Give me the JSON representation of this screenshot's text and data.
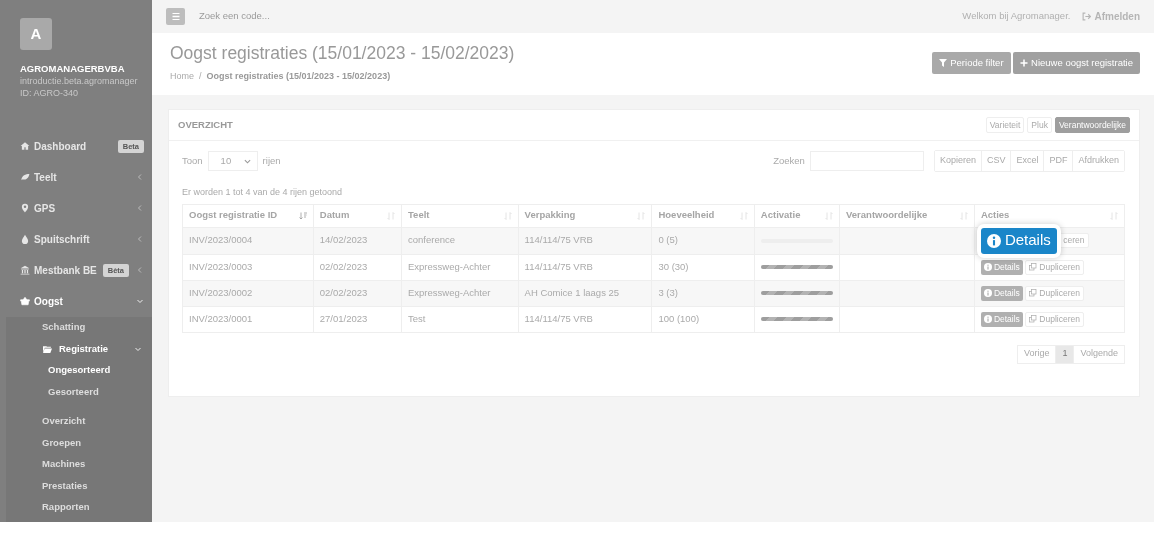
{
  "sidebar": {
    "logo": "A",
    "company": "AGROMANAGERBVBA",
    "subtitle": "introductie.beta.agromanager",
    "account_id": "ID: AGRO-340",
    "items": [
      {
        "label": "Dashboard",
        "badge": "Beta",
        "selected": false
      },
      {
        "label": "Teelt",
        "expanded": false,
        "selected": false
      },
      {
        "label": "GPS",
        "expanded": false,
        "selected": false
      },
      {
        "label": "Spuitschrift",
        "expanded": false,
        "selected": false
      },
      {
        "label": "Mestbank BE",
        "badge": "Bèta",
        "expanded": false,
        "selected": false
      },
      {
        "label": "Oogst",
        "expanded": true,
        "selected": true,
        "children": [
          {
            "label": "Schatting",
            "selected": false
          },
          {
            "label": "Registratie",
            "expanded": true,
            "selected": true,
            "children": [
              {
                "label": "Ongesorteerd",
                "selected": true
              },
              {
                "label": "Gesorteerd",
                "selected": false
              }
            ]
          },
          {
            "label": "Overzicht",
            "selected": false
          },
          {
            "label": "Groepen",
            "selected": false
          },
          {
            "label": "Machines",
            "selected": false
          },
          {
            "label": "Prestaties",
            "selected": false
          },
          {
            "label": "Rapporten",
            "selected": false
          }
        ]
      }
    ]
  },
  "topbar": {
    "search": {
      "placeholder": "Zoek een code..."
    },
    "welcome": "Welkom bij Agromanager.",
    "logout": "Afmelden"
  },
  "page": {
    "title": "Oogst registraties (15/01/2023 - 15/02/2023)",
    "breadcrumb_separator": "/",
    "breadcrumb": [
      "Home",
      "Oogst registraties (15/01/2023 - 15/02/2023)"
    ],
    "buttons": [
      "Periode filter",
      "Nieuwe oogst registratie"
    ]
  },
  "card": {
    "title": "OVERZICHT",
    "view_toggles": [
      {
        "label": "Varieteit",
        "selected": false
      },
      {
        "label": "Pluk",
        "selected": false
      },
      {
        "label": "Verantwoordelijke",
        "selected": true
      }
    ],
    "length": {
      "prefix": "Toon",
      "value": "10",
      "suffix": "rijen"
    },
    "search_label": "Zoeken",
    "export_buttons": [
      "Kopieren",
      "CSV",
      "Excel",
      "PDF",
      "Afdrukken"
    ],
    "info": "Er worden 1 tot 4 van de 4 rijen getoond",
    "table": {
      "columns": [
        {
          "label": "Oogst registratie ID",
          "sorted": true
        },
        {
          "label": "Datum",
          "sorted": false
        },
        {
          "label": "Teelt",
          "sorted": false
        },
        {
          "label": "Verpakking",
          "sorted": false
        },
        {
          "label": "Hoeveelheid",
          "sorted": false
        },
        {
          "label": "Activatie",
          "sorted": false
        },
        {
          "label": "Verantwoordelijke",
          "sorted": false
        },
        {
          "label": "Acties",
          "sorted": false
        }
      ],
      "rows": [
        {
          "id": "INV/2023/0004",
          "date": "14/02/2023",
          "crop": "conference",
          "packaging": "114/114/75 VRB",
          "quantity": "0 (5)",
          "level": 0,
          "details": "Details",
          "highlighted": true,
          "duplicate": "ceren"
        },
        {
          "id": "INV/2023/0003",
          "date": "02/02/2023",
          "crop": "Expressweg-Achter",
          "packaging": "114/114/75 VRB",
          "quantity": "30 (30)",
          "level": 1,
          "details": "Details",
          "highlighted": false,
          "duplicate": "Dupliceren"
        },
        {
          "id": "INV/2023/0002",
          "date": "02/02/2023",
          "crop": "Expressweg-Achter",
          "packaging": "AH Comice 1 laags 25",
          "quantity": "3 (3)",
          "level": 1,
          "details": "Details",
          "highlighted": false,
          "duplicate": "Dupliceren"
        },
        {
          "id": "INV/2023/0001",
          "date": "27/01/2023",
          "crop": "Test",
          "packaging": "114/114/75 VRB",
          "quantity": "100 (100)",
          "level": 1,
          "details": "Details",
          "highlighted": false,
          "duplicate": "Dupliceren"
        }
      ]
    },
    "pagination": [
      {
        "label": "Vorige",
        "selected": false
      },
      {
        "label": "1",
        "selected": true
      },
      {
        "label": "Volgende",
        "selected": false
      }
    ]
  }
}
